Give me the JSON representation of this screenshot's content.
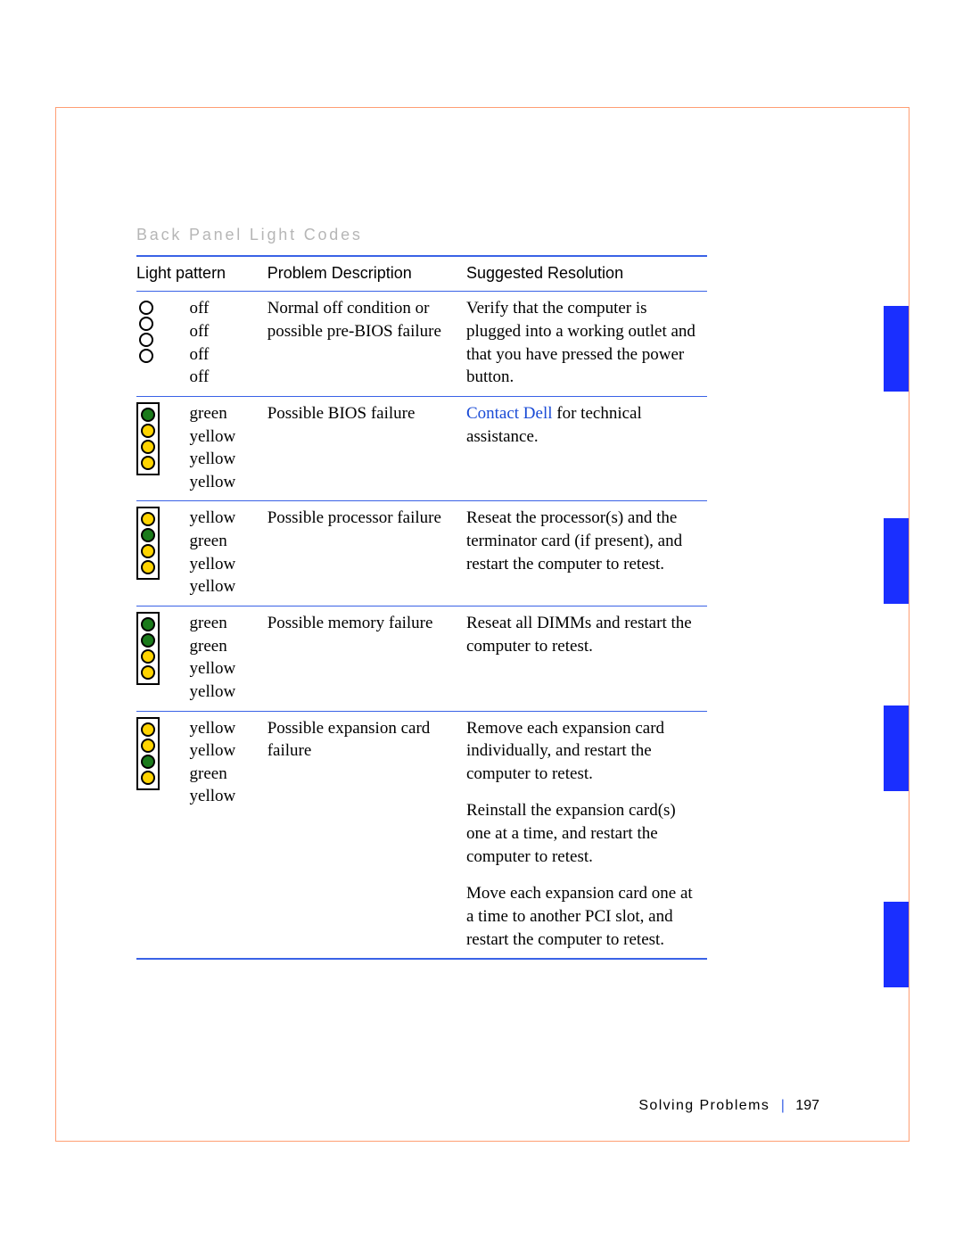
{
  "section_title": "Back Panel Light Codes",
  "headers": {
    "pattern": "Light pattern",
    "desc": "Problem Description",
    "res": "Suggested Resolution"
  },
  "rows": [
    {
      "lights": [
        "off",
        "off",
        "off",
        "off"
      ],
      "borderless": true,
      "labels": [
        "off",
        "off",
        "off",
        "off"
      ],
      "desc": "Normal off condition or possible pre-BIOS failure",
      "res_plain": "Verify that the computer is plugged into a working outlet and that you have pressed the power button."
    },
    {
      "lights": [
        "green",
        "yellow",
        "yellow",
        "yellow"
      ],
      "labels": [
        "green",
        "yellow",
        "yellow",
        "yellow"
      ],
      "desc": "Possible BIOS failure",
      "res_link": "Contact Dell",
      "res_after_link": " for technical assistance."
    },
    {
      "lights": [
        "yellow",
        "green",
        "yellow",
        "yellow"
      ],
      "labels": [
        "yellow",
        "green",
        "yellow",
        "yellow"
      ],
      "desc": "Possible processor failure",
      "res_plain": "Reseat the processor(s) and the terminator card (if present), and restart the computer to retest."
    },
    {
      "lights": [
        "green",
        "green",
        "yellow",
        "yellow"
      ],
      "labels": [
        "green",
        "green",
        "yellow",
        "yellow"
      ],
      "desc": "Possible memory failure",
      "res_plain": "Reseat all DIMMs and restart the computer to retest."
    },
    {
      "lights": [
        "yellow",
        "yellow",
        "green",
        "yellow"
      ],
      "labels": [
        "yellow",
        "yellow",
        "green",
        "yellow"
      ],
      "desc": "Possible expansion card failure",
      "res_multi": [
        "Remove each expansion card individually, and restart the computer to retest.",
        "Reinstall the expansion card(s) one at a time, and restart the computer to retest.",
        "Move each expansion card one at a time to another PCI slot, and restart the computer to retest."
      ]
    }
  ],
  "footer": {
    "label": "Solving Problems",
    "page": "197"
  }
}
